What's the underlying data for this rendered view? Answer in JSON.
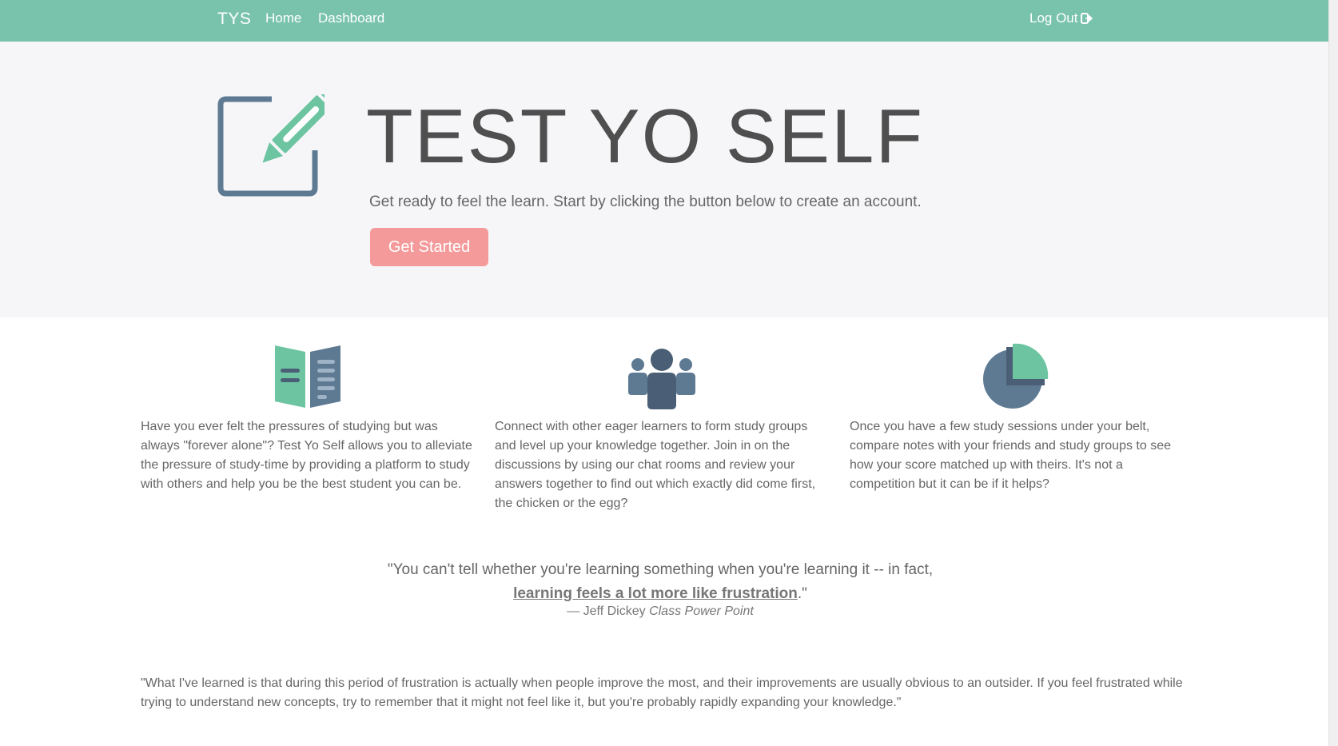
{
  "nav": {
    "brand": "TYS",
    "links": [
      "Home",
      "Dashboard"
    ],
    "logout": "Log Out"
  },
  "hero": {
    "title": "TEST YO SELF",
    "subtitle": "Get ready to feel the learn. Start by clicking the button below to create an account.",
    "button": "Get Started"
  },
  "features": [
    {
      "icon": "book-icon",
      "text": "Have you ever felt the pressures of studying but was always \"forever alone\"? Test Yo Self allows you to alleviate the pressure of study-time by providing a platform to study with others and help you be the best student you can be."
    },
    {
      "icon": "group-icon",
      "text": "Connect with other eager learners to form study groups and level up your knowledge together. Join in on the discussions by using our chat rooms and review your answers together to find out which exactly did come first, the chicken or the egg?"
    },
    {
      "icon": "pie-chart-icon",
      "text": "Once you have a few study sessions under your belt, compare notes with your friends and study groups to see how your score matched up with theirs. It's not a competition but it can be if it helps?"
    }
  ],
  "quote": {
    "before": "\"You can't tell whether you're learning something when you're learning it -- in fact,",
    "link": "learning feels a lot more like frustration",
    "after": ".\"",
    "author": "— Jeff Dickey",
    "source": "Class Power Point"
  },
  "quote2": "\"What I've learned is that during this period of frustration is actually when people improve the most, and their improvements are usually obvious to an outsider. If you feel frustrated while trying to understand new concepts, try to remember that it might not feel like it, but you're probably rapidly expanding your knowledge.\"",
  "colors": {
    "navbar": "#79c3ad",
    "hero_bg": "#f6f6f8",
    "button": "#f49a9a",
    "icon_green": "#6cc4a1",
    "icon_slate": "#5e7a93",
    "icon_dark": "#4a5f75"
  }
}
